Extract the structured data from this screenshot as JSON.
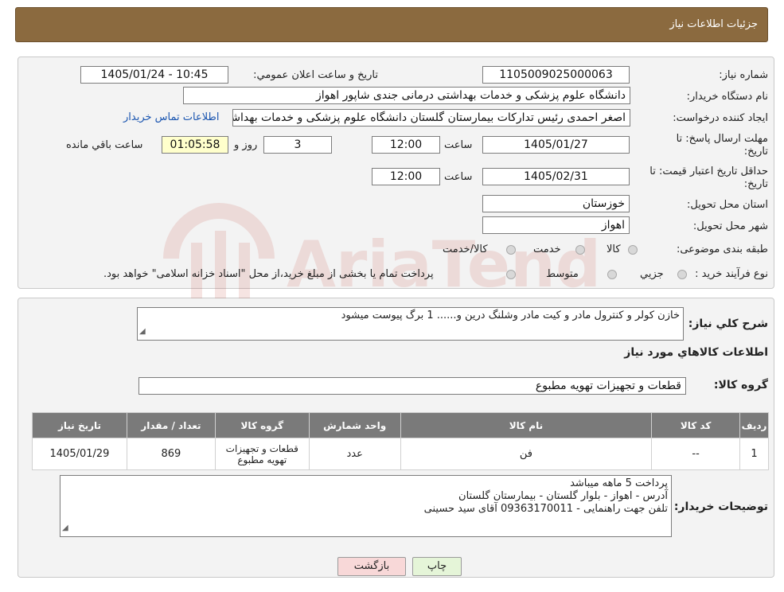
{
  "header": {
    "title": "جزئیات اطلاعات نیاز"
  },
  "form": {
    "need_number_label": "شماره نیاز:",
    "need_number": "1105009025000063",
    "announce_label": "تاریخ و ساعت اعلان عمومي:",
    "announce_value": "1405/01/24 - 10:45",
    "buyer_org_label": "نام دستگاه خريدار:",
    "buyer_org": "دانشگاه علوم پزشکی و خدمات بهداشتی درمانی جندی شاپور اهواز",
    "creator_label": "ايجاد کننده درخواست:",
    "creator": "اصغر احمدی رئیس تداركات بیمارستان گلستان دانشگاه علوم پزشکی و خدمات بهداشتی درمانی جندی شاپور اهواز",
    "contact_link": "اطلاعات تماس خريدار",
    "deadline_label_1": "مهلت ارسال پاسخ: تا",
    "deadline_label_2": "تاريخ:",
    "deadline_date": "1405/01/27",
    "time_label": "ساعت",
    "deadline_time": "12:00",
    "days_value": "3",
    "days_label": "روز و",
    "remaining_value": "01:05:58",
    "remaining_label": "ساعت باقي مانده",
    "validity_label_1": "حداقل تاريخ اعتبار قيمت: تا",
    "validity_label_2": "تاريخ:",
    "validity_date": "1405/02/31",
    "validity_time": "12:00",
    "province_label": "استان محل تحويل:",
    "province": "خوزستان",
    "city_label": "شهر محل تحويل:",
    "city": "اهواز",
    "category_label": "طبقه بندی موضوعی:",
    "category_options": [
      "کالا",
      "خدمت",
      "کالا/خدمت"
    ],
    "process_label": "نوع فرآيند خريد :",
    "process_options": [
      "جزيي",
      "متوسط"
    ],
    "process_note": "پرداخت تمام يا بخشی از مبلغ خريد،از محل \"اسناد خزانه اسلامی\" خواهد بود."
  },
  "details": {
    "summary_label": "شرح کلي نياز:",
    "summary": "خازن کولر و کنترول مادر و کیت مادر وشلنگ درین و...... 1 برگ پیوست میشود",
    "items_heading": "اطلاعات کالاهاي مورد نياز",
    "group_label": "گروه کالا:",
    "group_value": "قطعات و تجهیزات تهویه مطبوع",
    "table": {
      "headers": [
        "رديف",
        "کد کالا",
        "نام کالا",
        "واحد شمارش",
        "گروه کالا",
        "تعداد / مقدار",
        "تاريخ نياز"
      ],
      "rows": [
        [
          "1",
          "--",
          "فن",
          "عدد",
          "قطعات و تجهیزات تهویه مطبوع",
          "869",
          "1405/01/29"
        ]
      ]
    },
    "buyer_notes_label": "توضيحات خريدار:",
    "buyer_notes": [
      "پرداخت 5 ماهه میباشد",
      "آدرس - اهواز - بلوار گلستان - بیمارستان گلستان",
      "تلفن جهت راهنمایی - 09363170011 آقای سید حسینی"
    ]
  },
  "buttons": {
    "print": "چاپ",
    "back": "بازگشت"
  },
  "watermark": {
    "text": "AriaTender.neT",
    "color": "#c0392b"
  }
}
